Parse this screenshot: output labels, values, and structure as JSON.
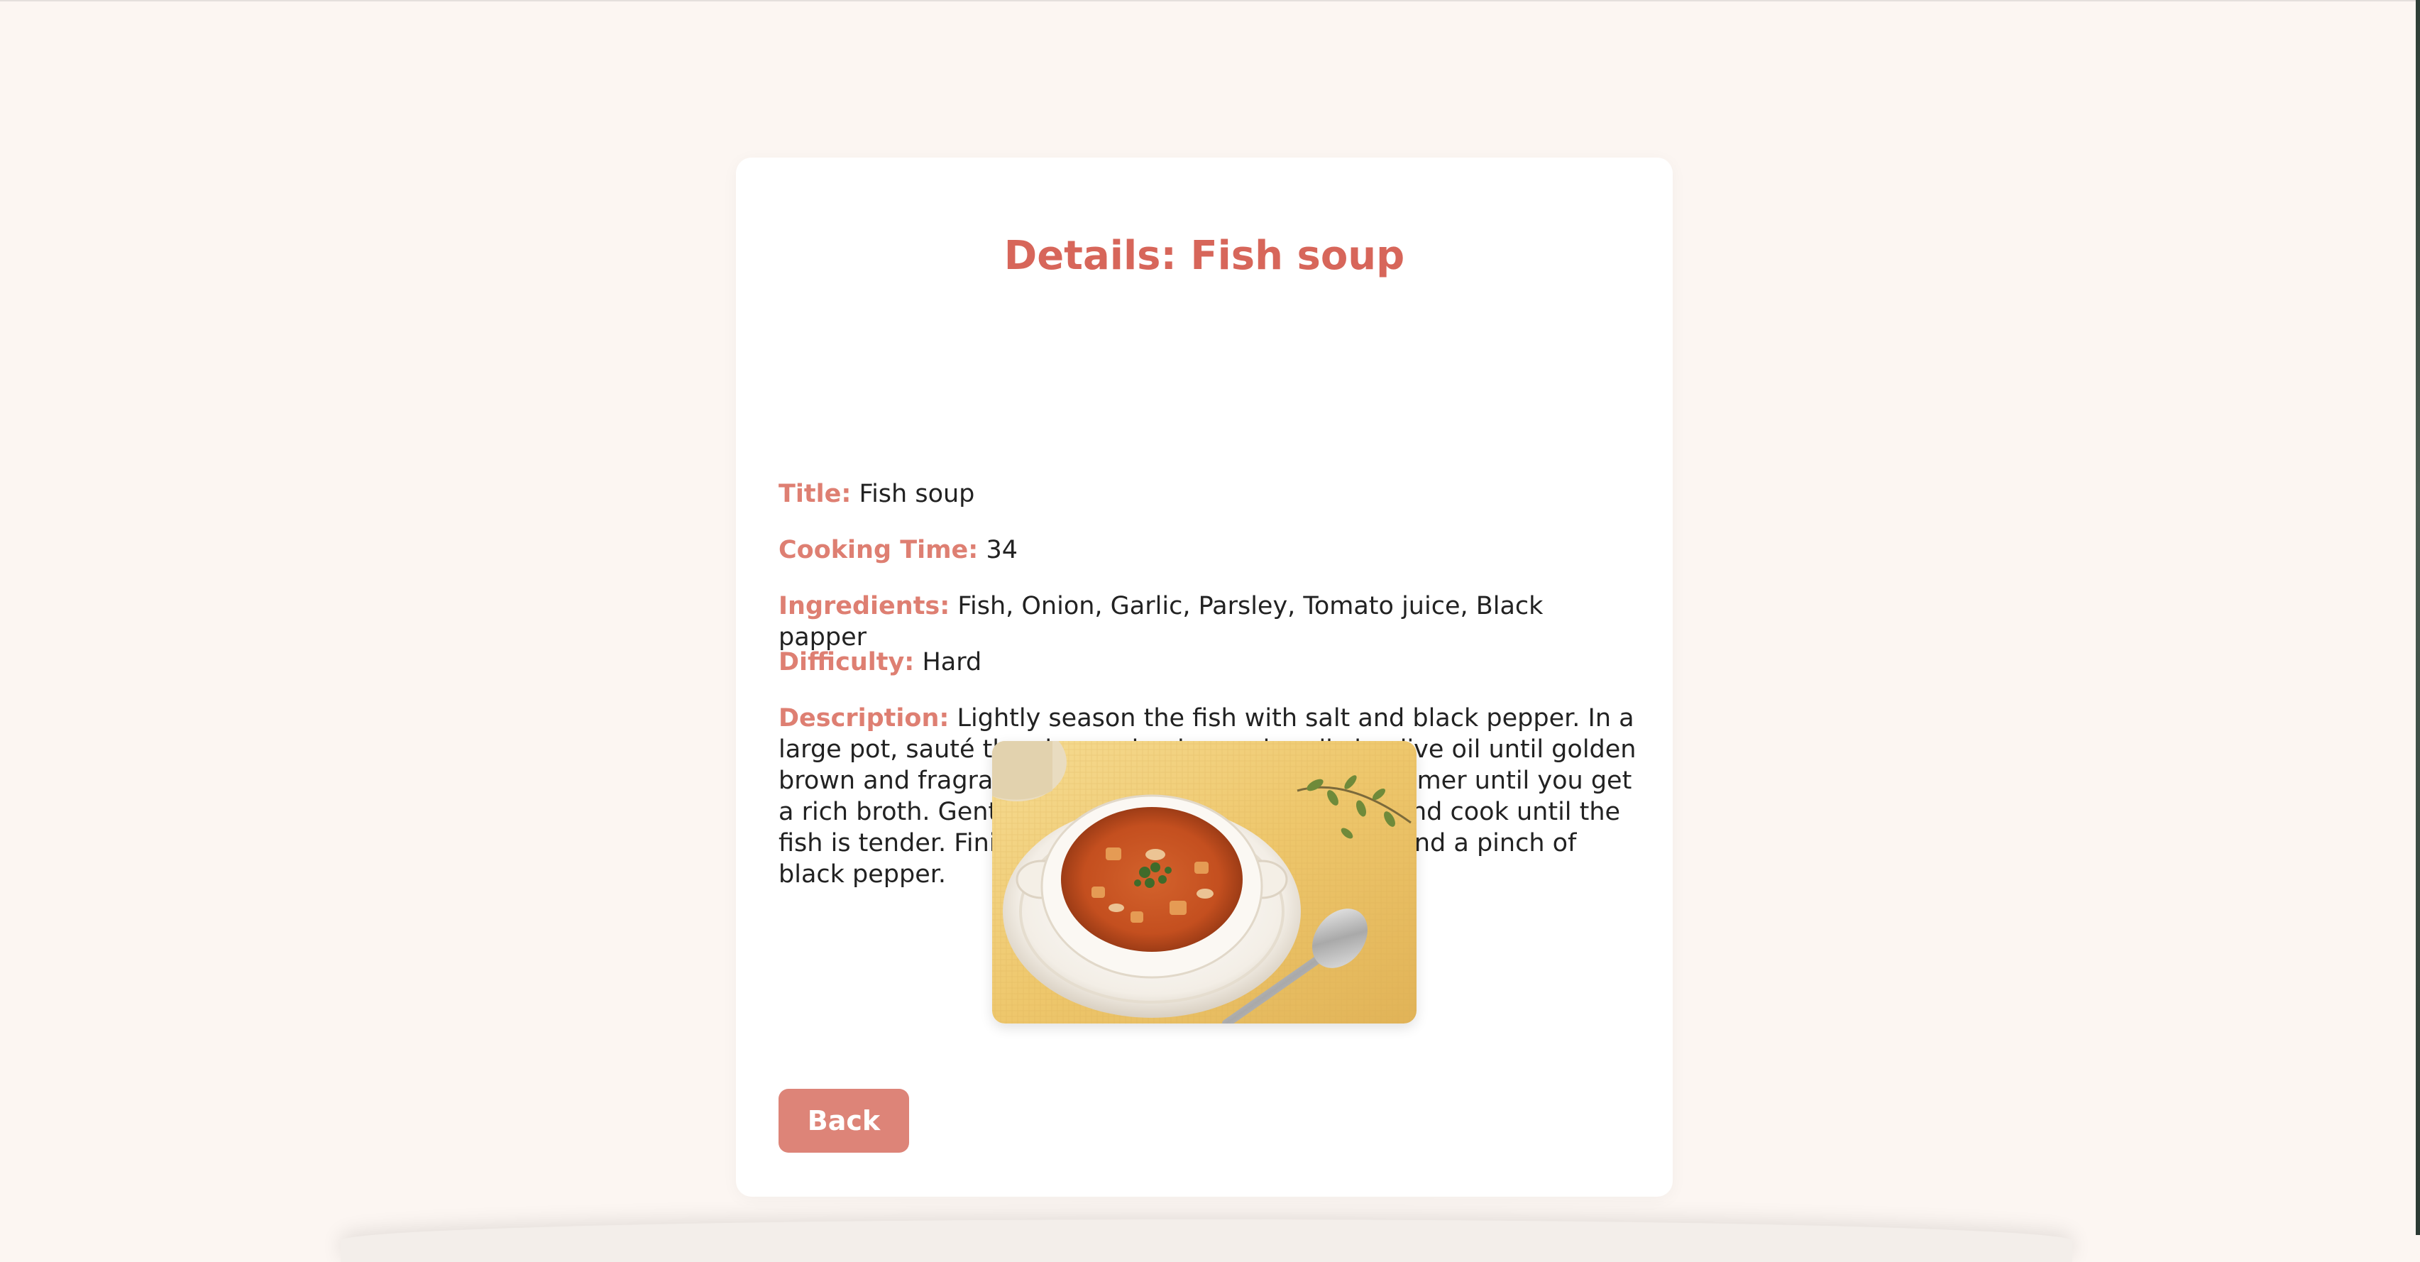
{
  "details": {
    "heading": "Details: Fish soup",
    "fields": [
      {
        "label": "Title:",
        "value": "Fish soup"
      },
      {
        "label": "Cooking Time:",
        "value": "34"
      },
      {
        "label": "Ingredients:",
        "value": "Fish, Onion, Garlic, Parsley, Tomato juice, Black papper"
      },
      {
        "label": "Difficulty:",
        "value": "Hard"
      },
      {
        "label": "Description:",
        "value": "Lightly season the fish with salt and black pepper. In a large pot, sauté the chopped onion and garlic in olive oil until golden brown and fragrant. Add tomato juice and let it simmer until you get a rich broth. Gently add the fish in the pot, cover and cook until the fish is tender. Finish with freshly chopped parsley and a pinch of black pepper."
      }
    ],
    "back_label": "Back"
  },
  "colors": {
    "page_background": "#fcf6f2",
    "heading": "#d7665a",
    "label": "#de7f72",
    "button": "#dd8478"
  }
}
